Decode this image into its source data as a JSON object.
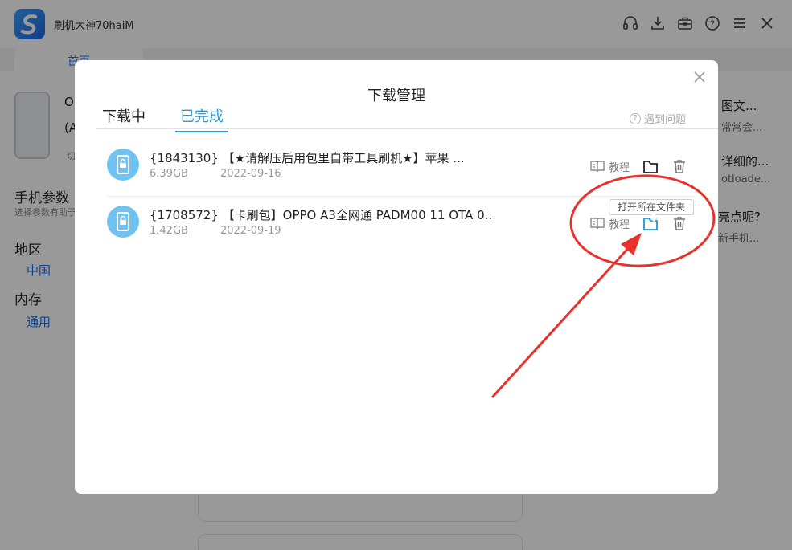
{
  "app": {
    "title": "刷机大神70haiM",
    "home_tab": "首页"
  },
  "background": {
    "phone_model_initial": "O",
    "phone_model_sub": "(A",
    "switch_hint": "切",
    "params_title": "手机参数",
    "params_hint": "选择参数有助于",
    "region_label": "地区",
    "region_value": "中国",
    "memory_label": "内存",
    "memory_value": "通用",
    "right_items": [
      "图文...",
      "常常会...",
      "详细的...",
      "otloade...",
      "亮点呢?",
      "新手机..."
    ]
  },
  "dialog": {
    "title": "下载管理",
    "tabs": [
      "下载中",
      "已完成"
    ],
    "active_tab": "已完成",
    "help_label": "遇到问题",
    "items": [
      {
        "name": "{1843130} 【★请解压后用包里自带工具刷机★】苹果 ...",
        "size": "6.39GB",
        "date": "2022-09-16",
        "tutorial_label": "教程"
      },
      {
        "name": "{1708572} 【卡刷包】OPPO A3全网通 PADM00 11 OTA 0..",
        "size": "1.42GB",
        "date": "2022-09-19",
        "tutorial_label": "教程"
      }
    ],
    "tooltip": "打开所在文件夹"
  },
  "colors": {
    "accent": "#1f9ad6",
    "annotation": "#e8322b",
    "file_icon_bg": "#6fc2f2"
  }
}
